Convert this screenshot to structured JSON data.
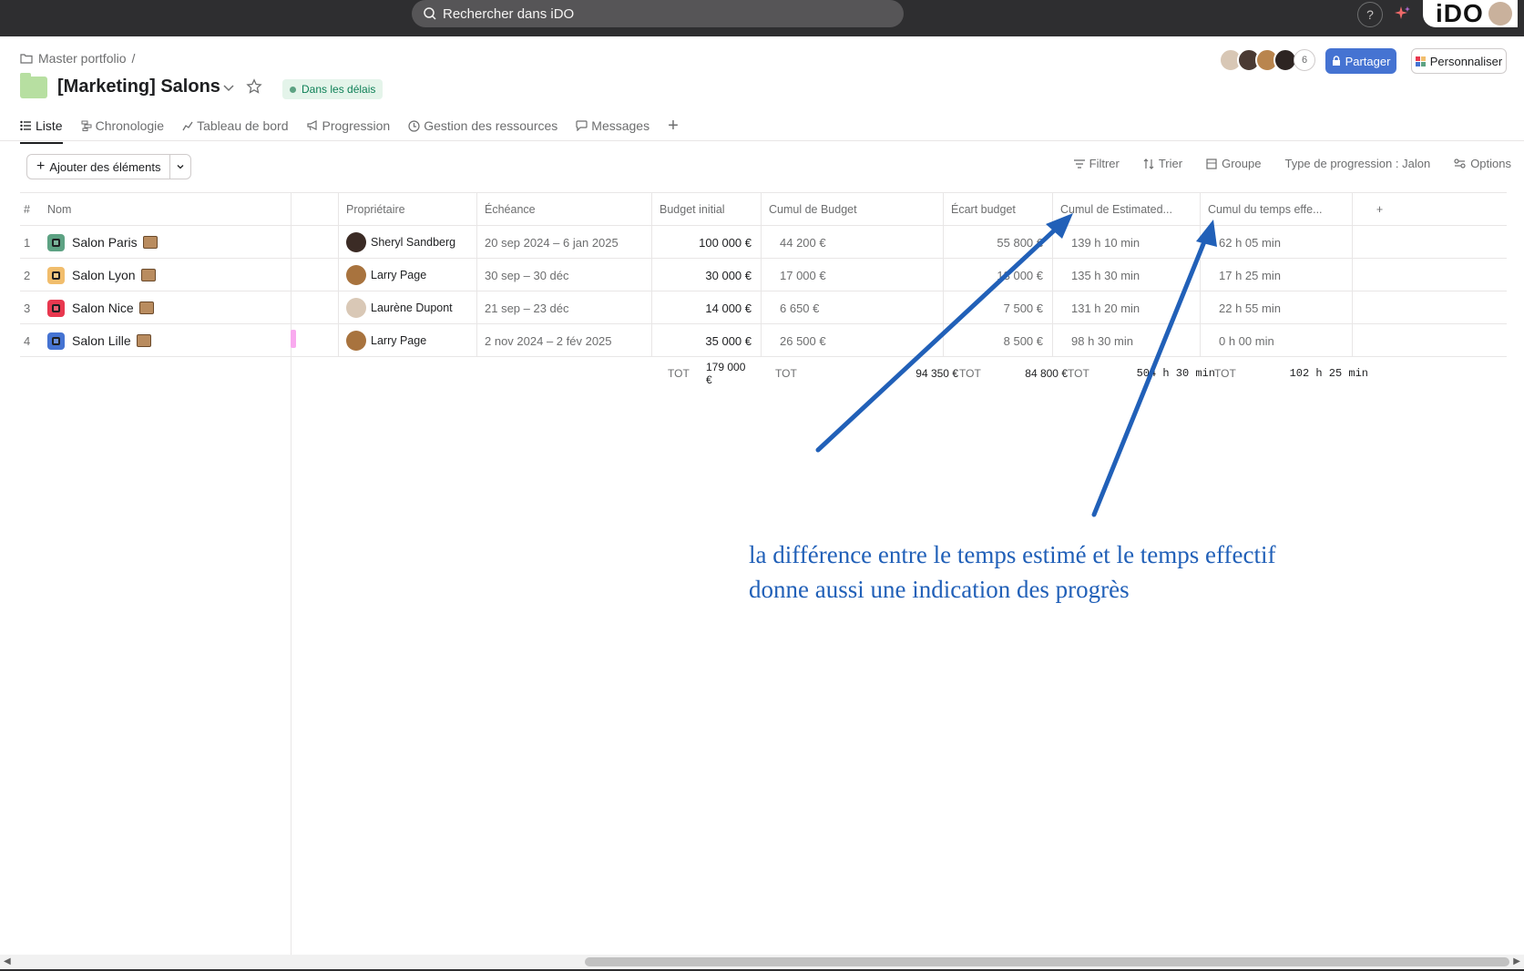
{
  "search": {
    "placeholder": "Rechercher dans iDO"
  },
  "top": {
    "help": "?",
    "logo": "iDO"
  },
  "breadcrumb": {
    "parent": "Master portfolio",
    "sep": "/"
  },
  "project": {
    "title": "[Marketing] Salons",
    "status": "Dans les délais"
  },
  "members": {
    "count": "6"
  },
  "actions": {
    "share": "Partager",
    "customize": "Personnaliser"
  },
  "tabs": [
    {
      "label": "Liste",
      "icon": "list-icon"
    },
    {
      "label": "Chronologie",
      "icon": "timeline-icon"
    },
    {
      "label": "Tableau de bord",
      "icon": "chart-icon"
    },
    {
      "label": "Progression",
      "icon": "megaphone-icon"
    },
    {
      "label": "Gestion des ressources",
      "icon": "resource-icon"
    },
    {
      "label": "Messages",
      "icon": "message-icon"
    }
  ],
  "toolbar": {
    "add": "Ajouter des éléments",
    "filter": "Filtrer",
    "sort": "Trier",
    "group": "Groupe",
    "progress_type": "Type de progression : Jalon",
    "options": "Options"
  },
  "columns": {
    "num": "#",
    "name": "Nom",
    "owner": "Propriétaire",
    "due": "Échéance",
    "budget_initial": "Budget initial",
    "budget_cumul": "Cumul de Budget",
    "budget_gap": "Écart budget",
    "est_cumul": "Cumul de Estimated...",
    "eff_cumul": "Cumul du temps effe..."
  },
  "rows": [
    {
      "num": "1",
      "name": "Salon Paris",
      "color": "#5da283",
      "owner": "Sheryl Sandberg",
      "due": "20 sep 2024 – 6 jan 2025",
      "budget_initial": "100 000 €",
      "budget_cumul": "44 200 €",
      "budget_gap": "55 800 €",
      "est": "139 h 10 min",
      "eff": "62 h 05 min"
    },
    {
      "num": "2",
      "name": "Salon Lyon",
      "color": "#f1bd6c",
      "owner": "Larry Page",
      "due": "30 sep – 30 déc",
      "budget_initial": "30 000 €",
      "budget_cumul": "17 000 €",
      "budget_gap": "13 000 €",
      "est": "135 h 30 min",
      "eff": "17 h 25 min"
    },
    {
      "num": "3",
      "name": "Salon Nice",
      "color": "#e8384f",
      "owner": "Laurène Dupont",
      "due": "21 sep – 23 déc",
      "budget_initial": "14 000 €",
      "budget_cumul": "6 650 €",
      "budget_gap": "7 500 €",
      "est": "131 h 20 min",
      "eff": "22 h 55 min"
    },
    {
      "num": "4",
      "name": "Salon Lille",
      "color": "#4573d2",
      "owner": "Larry Page",
      "due": "2 nov 2024 – 2 fév 2025",
      "budget_initial": "35 000 €",
      "budget_cumul": "26 500 €",
      "budget_gap": "8 500 €",
      "est": "98 h 30 min",
      "eff": "0 h 00 min"
    }
  ],
  "totals": {
    "label": "TOT",
    "budget_initial": "179 000 €",
    "budget_cumul": "94 350 €",
    "budget_gap": "84 800 €",
    "est": "504 h 30 min",
    "eff": "102 h 25 min"
  },
  "annotation": {
    "line1": "la différence entre le temps estimé et le temps effectif",
    "line2": "donne aussi une indication des progrès",
    "color": "#2160b8"
  }
}
